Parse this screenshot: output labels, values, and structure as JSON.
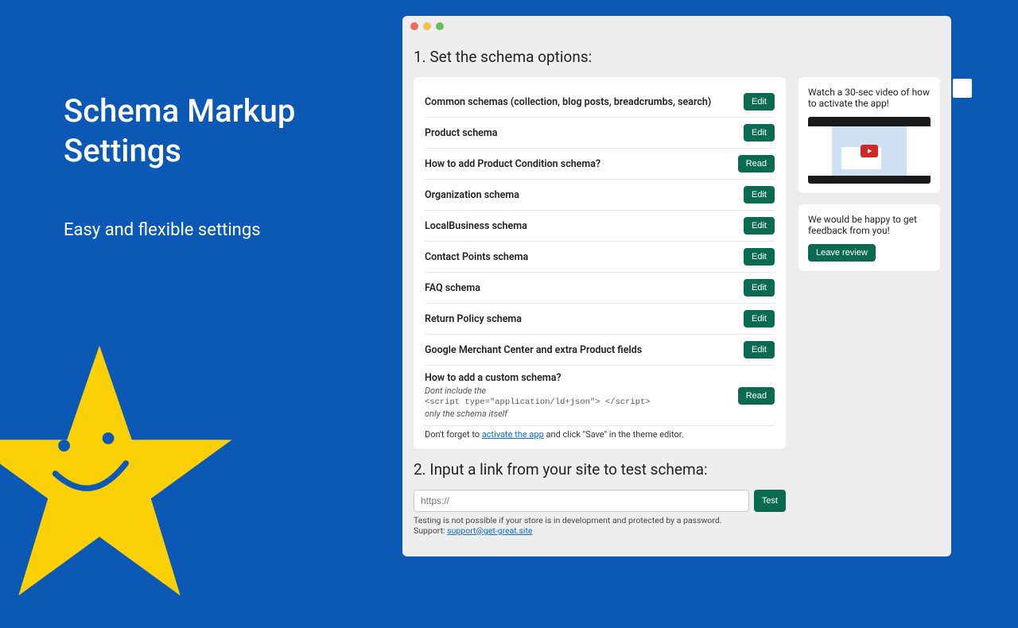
{
  "left": {
    "title_line1": "Schema Markup",
    "title_line2": "Settings",
    "subtitle": "Easy and flexible settings"
  },
  "window": {
    "section1_title": "1. Set the schema options:",
    "rows": [
      {
        "label": "Common schemas (collection, blog posts, breadcrumbs, search)",
        "button": "Edit"
      },
      {
        "label": "Product schema",
        "button": "Edit"
      },
      {
        "label": "How to add Product Condition schema?",
        "button": "Read"
      },
      {
        "label": "Organization schema",
        "button": "Edit"
      },
      {
        "label": "LocalBusiness schema",
        "button": "Edit"
      },
      {
        "label": "Contact Points schema",
        "button": "Edit"
      },
      {
        "label": "FAQ schema",
        "button": "Edit"
      },
      {
        "label": "Return Policy schema",
        "button": "Edit"
      },
      {
        "label": "Google Merchant Center and extra Product fields",
        "button": "Edit"
      }
    ],
    "custom_row": {
      "label": "How to add a custom schema?",
      "sub1": "Dont include the",
      "code": "<script type=\"application/ld+json\"> </scr",
      "code2": "ipt>",
      "sub2": "only the schema itself",
      "button": "Read"
    },
    "footnote_prefix": "Don't forget to ",
    "footnote_link": "activate the app",
    "footnote_suffix": " and click \"Save\" in the theme editor.",
    "section2_title": "2. Input a link from your site to test schema:",
    "input_placeholder": "https://",
    "test_button": "Test",
    "test_note": "Testing is not possible if your store is in development and protected by a password.",
    "support_prefix": "Support: ",
    "support_link": "support@get-great.site",
    "side_video_text": "Watch a 30-sec video of how to activate the app!",
    "side_feedback_text": "We would be happy to get feedback from you!",
    "review_button": "Leave review"
  }
}
